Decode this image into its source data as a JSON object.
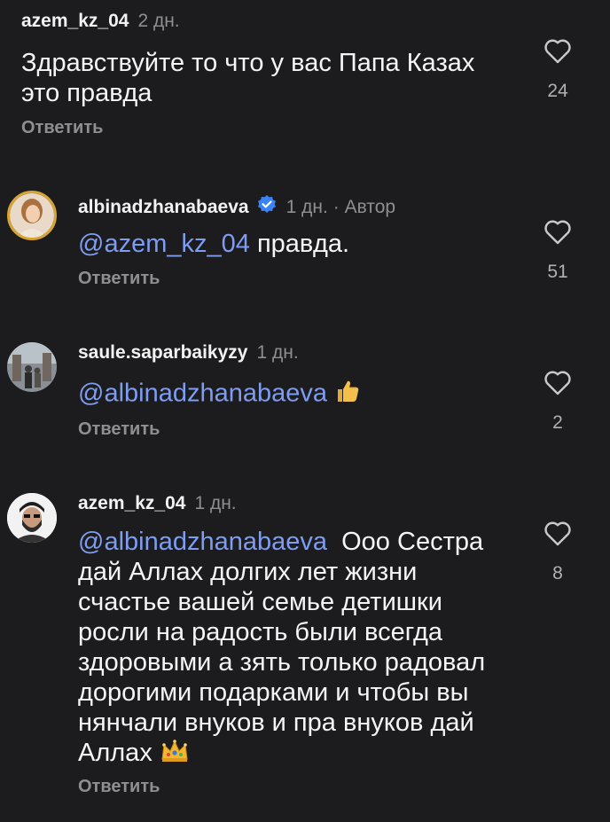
{
  "comments": [
    {
      "username": "azem_kz_04",
      "time": "2 дн.",
      "text": "Здравствуйте то что у вас Папа Казах это правда",
      "reply_label": "Ответить",
      "likes": "24"
    },
    {
      "username": "albinadzhanabaeva",
      "verified": true,
      "time": "1 дн.",
      "author_label": "· Автор",
      "mention": "@azem_kz_04",
      "text": "правда.",
      "reply_label": "Ответить",
      "likes": "51"
    },
    {
      "username": "saule.saparbaikyzy",
      "time": "1 дн.",
      "mention": "@albinadzhanabaeva",
      "emoji": "thumbs-up",
      "reply_label": "Ответить",
      "likes": "2"
    },
    {
      "username": "azem_kz_04",
      "time": "1 дн.",
      "mention": "@albinadzhanabaeva",
      "text_line1": "Ооо Сестра",
      "text_rest": "дай Аллах долгих лет жизни счастье вашей семье детишки росли на радость были всегда здоровыми а зять только радовал дорогими подарками и чтобы вы нянчали внуков и пра внуков дай Аллах",
      "emoji": "crown",
      "reply_label": "Ответить",
      "likes": "8"
    }
  ],
  "colors": {
    "background": "#1c1c1e",
    "mention": "#7e9cf0",
    "secondary_text": "#8e8e93",
    "verified_badge": "#3b82f6"
  },
  "icons": [
    "heart-icon",
    "verified-badge-icon",
    "thumbs-up-icon",
    "crown-icon"
  ]
}
